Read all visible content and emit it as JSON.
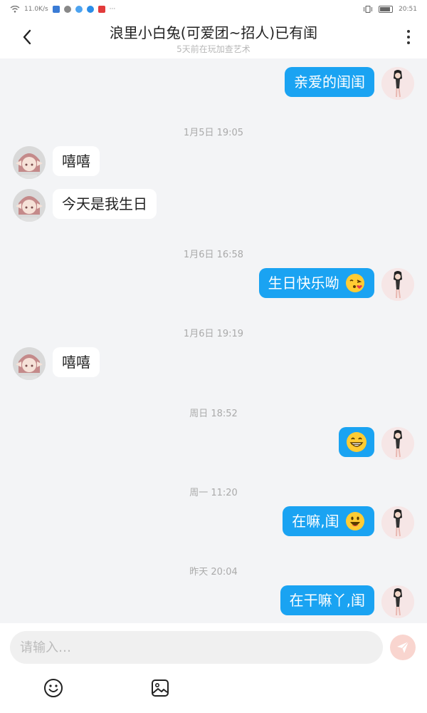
{
  "status_bar": {
    "network_speed": "11.0K/s",
    "time": "20:51"
  },
  "header": {
    "title": "浪里小白兔(可爱团~招人)已有闺",
    "subtitle": "5天前在玩加查艺术"
  },
  "messages": [
    {
      "type": "outgoing",
      "text": "亲爱的闺闺"
    },
    {
      "type": "timestamp",
      "text": "1月5日 19:05"
    },
    {
      "type": "incoming",
      "text": "嘻嘻"
    },
    {
      "type": "incoming",
      "text": "今天是我生日"
    },
    {
      "type": "timestamp",
      "text": "1月6日 16:58"
    },
    {
      "type": "outgoing",
      "text": "生日快乐呦",
      "emoji": "kiss-emoji"
    },
    {
      "type": "timestamp",
      "text": "1月6日 19:19"
    },
    {
      "type": "incoming",
      "text": "嘻嘻"
    },
    {
      "type": "timestamp",
      "text": "周日 18:52"
    },
    {
      "type": "outgoing",
      "text": "",
      "emoji": "grin-emoji"
    },
    {
      "type": "timestamp",
      "text": "周一 11:20"
    },
    {
      "type": "outgoing",
      "text": "在嘛,闺",
      "emoji": "smile-emoji"
    },
    {
      "type": "timestamp",
      "text": "昨天 20:04"
    },
    {
      "type": "outgoing",
      "text": "在干嘛丫,闺"
    }
  ],
  "input": {
    "placeholder": "请输入…",
    "value": ""
  },
  "icons": {
    "back": "back-arrow-icon",
    "more": "more-vertical-icon",
    "send": "send-icon",
    "emoji": "emoji-icon",
    "image": "image-icon"
  },
  "colors": {
    "outgoing_bubble": "#1aa3f2",
    "incoming_bubble": "#ffffff",
    "background": "#f3f4f6",
    "send_button": "#f9d5cf"
  }
}
